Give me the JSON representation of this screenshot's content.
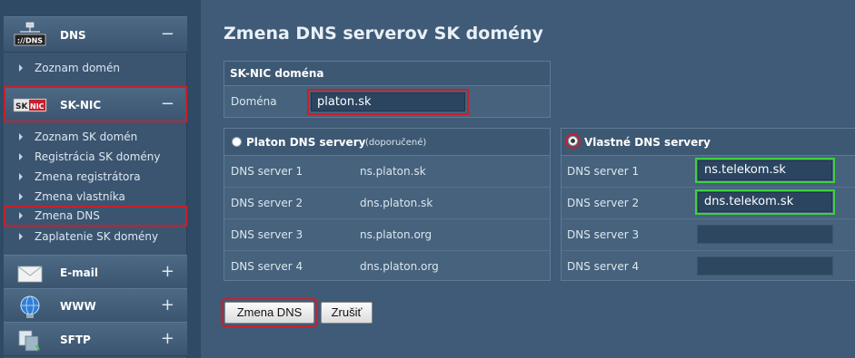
{
  "sidebar": {
    "dns": {
      "title": "DNS",
      "toggle": "−",
      "icon": "dns-icon",
      "items": [
        {
          "label": "Zoznam domén"
        }
      ]
    },
    "sknic": {
      "title": "SK-NIC",
      "toggle": "−",
      "icon": "sknic-icon",
      "items": [
        {
          "label": "Zoznam SK domén"
        },
        {
          "label": "Registrácia SK domény"
        },
        {
          "label": "Zmena registrátora"
        },
        {
          "label": "Zmena vlastníka"
        },
        {
          "label": "Zmena DNS"
        },
        {
          "label": "Zaplatenie SK domény"
        }
      ]
    },
    "email": {
      "title": "E-mail",
      "toggle": "+",
      "icon": "envelope-icon"
    },
    "www": {
      "title": "WWW",
      "toggle": "+",
      "icon": "globe-icon"
    },
    "sftp": {
      "title": "SFTP",
      "toggle": "+",
      "icon": "sftp-icon"
    }
  },
  "main": {
    "title": "Zmena DNS serverov SK domény",
    "domain_box": {
      "header": "SK-NIC doména",
      "label": "Doména",
      "value": "platon.sk"
    },
    "platon_box": {
      "header": "Platon DNS servery",
      "header_note": "(doporučené)",
      "selected": false,
      "rows": [
        {
          "label": "DNS server 1",
          "value": "ns.platon.sk"
        },
        {
          "label": "DNS server 2",
          "value": "dns.platon.sk"
        },
        {
          "label": "DNS server 3",
          "value": "ns.platon.org"
        },
        {
          "label": "DNS server 4",
          "value": "dns.platon.org"
        }
      ]
    },
    "own_box": {
      "header": "Vlastné DNS servery",
      "selected": true,
      "rows": [
        {
          "label": "DNS server 1",
          "value": "ns.telekom.sk"
        },
        {
          "label": "DNS server 2",
          "value": "dns.telekom.sk"
        },
        {
          "label": "DNS server 3",
          "value": ""
        },
        {
          "label": "DNS server 4",
          "value": ""
        }
      ]
    },
    "buttons": {
      "submit": "Zmena DNS",
      "cancel": "Zrušiť"
    }
  },
  "colors": {
    "background": "#3f5b78",
    "highlight_red": "#c8202c",
    "highlight_green": "#3fcf3f"
  }
}
